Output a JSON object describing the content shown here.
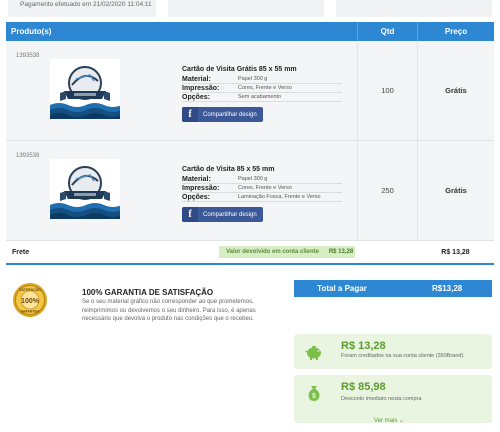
{
  "top": {
    "payment_note": "Pagamento efetuado em 21/02/2020 11:04:11"
  },
  "table": {
    "headers": {
      "product": "Produto(s)",
      "qty": "Qtd",
      "price": "Preço"
    },
    "rows": [
      {
        "code": "1393538",
        "title": "Cartão de Visita Grátis 85 x 55 mm",
        "attrs": [
          {
            "k": "Material:",
            "v": "Papel 300 g"
          },
          {
            "k": "Impressão:",
            "v": "Cores, Frente e Verso"
          },
          {
            "k": "Opções:",
            "v": "Sem acabamento"
          }
        ],
        "share": "Compartilhar design",
        "qty": "100",
        "price": "Grátis"
      },
      {
        "code": "1393539",
        "title": "Cartão de Visita 85 x 55 mm",
        "attrs": [
          {
            "k": "Material:",
            "v": "Papel 300 g"
          },
          {
            "k": "Impressão:",
            "v": "Cores, Frente e Verso"
          },
          {
            "k": "Opções:",
            "v": "Laminação Fosca, Frente e Verso"
          }
        ],
        "share": "Compartilhar design",
        "qty": "250",
        "price": "Grátis"
      }
    ],
    "frete": {
      "label": "Frete",
      "returned_label": "Valor devolvido em conta cliente",
      "returned_value": "R$ 13,28",
      "value": "R$ 13,28"
    }
  },
  "guarantee": {
    "seal_top": "SATISFAÇÃO",
    "seal_center": "100%",
    "seal_bottom": "GARANTIDA",
    "title": "100% GARANTIA DE SATISFAÇÃO",
    "text": "Se o seu material gráfico não corresponder ao que prometemos, reimprimimos ou devolvemos o seu dinheiro. Para isso, é apenas necessário que devolva o produto nas condições que o recebeu."
  },
  "total": {
    "label": "Total a Pagar",
    "value": "R$13,28"
  },
  "credits": [
    {
      "amount": "R$ 13,28",
      "desc": "Foram creditados na sua conta cliente (360Brand).",
      "icon": "piggy-bank-icon"
    },
    {
      "amount": "R$ 85,98",
      "desc": "Desconto imediato nesta compra",
      "icon": "money-bag-icon"
    }
  ],
  "ver_mais": "Ver mais ⌄",
  "colors": {
    "accent": "#2d87d3",
    "facebook": "#3b5998",
    "credit_bg": "#e9f5e1",
    "credit_text": "#5b9b2e"
  }
}
